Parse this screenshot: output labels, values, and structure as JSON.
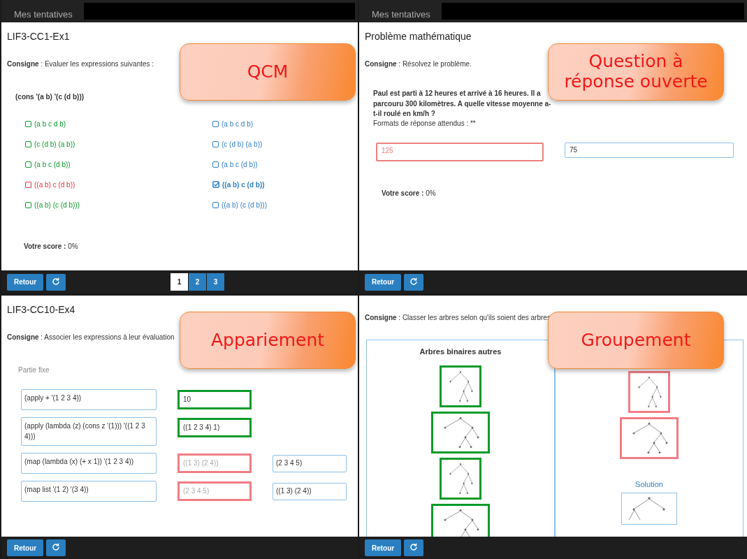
{
  "panels": [
    {
      "kind": "qcm",
      "header": {
        "tab": "Mes tentatives"
      },
      "title": "LIF3-CC1-Ex1",
      "instruction": "**Consigne** : Evaluer les expressions suivantes :",
      "question": "(cons '(a b) '(c (d b)))",
      "answers": [
        {
          "text": "(a b c d b)",
          "correct": true
        },
        {
          "text": "(c (d b) (a b))",
          "correct": true
        },
        {
          "text": "(a b c (d b))",
          "correct": true
        },
        {
          "text": "((a b) c (d b))",
          "correct": false
        },
        {
          "text": "((a b) (c (d b)))",
          "correct": true
        }
      ],
      "choices": [
        {
          "text": "(a b c d b)",
          "checked": false
        },
        {
          "text": "(c (d b) (a b))",
          "checked": false
        },
        {
          "text": "(a b c (d b))",
          "checked": false
        },
        {
          "text": "((a b) c (d b))",
          "checked": true
        },
        {
          "text": "((a b) (c (d b)))",
          "checked": false
        }
      ],
      "score": "**Votre score :** 0%",
      "back_button": "Retour",
      "pages": [
        {
          "label": "1",
          "selected": true
        },
        {
          "label": "2",
          "selected": false
        },
        {
          "label": "3",
          "selected": false
        }
      ],
      "callout": "QCM"
    },
    {
      "kind": "open",
      "header": {
        "tab": "Mes tentatives"
      },
      "title": "Problème mathématique",
      "instruction": "**Consigne** : Résolvez le problème.",
      "question": "Paul est parti à 12 heures et arrivé à 16 heures. Il a parcouru 300 kilomètres. A quelle vitesse moyenne a-t-il roulé en km/h ?",
      "formats": "Formats de réponse attendus : **",
      "answer": {
        "text": "125",
        "correct": false
      },
      "solution": "75",
      "score": "**Votre score :** 0%",
      "back_button": "Retour",
      "callout": "Question à réponse ouverte"
    },
    {
      "kind": "matching",
      "title": "LIF3-CC10-Ex4",
      "instruction": "**Consigne** : Associer les expressions à leur évaluation",
      "column_1": "Partie fixe",
      "rows": [
        {
          "fixed": "(apply + '(1 2 3 4))",
          "answer": {
            "text": "10",
            "correct": true
          }
        },
        {
          "fixed": "(apply (lambda (z) (cons z '(1))) '((1 2 3 4)))",
          "answer": {
            "text": "((1 2 3 4) 1)",
            "correct": true
          }
        },
        {
          "fixed": "(map (lambda (x) (+ x 1)) '(1 2 3 4))",
          "answer": {
            "text": "((1 3) (2 4))",
            "correct": false
          },
          "solution": "(2 3 4 5)"
        },
        {
          "fixed": "(map list '(1 2) '(3 4))",
          "answer": {
            "text": "(2 3 4 5)",
            "correct": false
          },
          "solution": "((1 3) (2 4))"
        }
      ],
      "back_button": "Retour",
      "callout": "Appariement"
    },
    {
      "kind": "grouping",
      "instruction": "**Consigne** : Classer les arbres selon qu'ils soient des arbres",
      "groups": [
        {
          "title": "Arbres binaires autres",
          "trees": [
            {
              "correct": true
            },
            {
              "correct": true
            },
            {
              "correct": true
            },
            {
              "correct": true
            }
          ]
        },
        {
          "trees": [
            {
              "correct": false
            },
            {
              "correct": false
            }
          ],
          "solution_label": "Solution"
        }
      ],
      "back_button": "Retour",
      "callout": "Groupement"
    }
  ]
}
